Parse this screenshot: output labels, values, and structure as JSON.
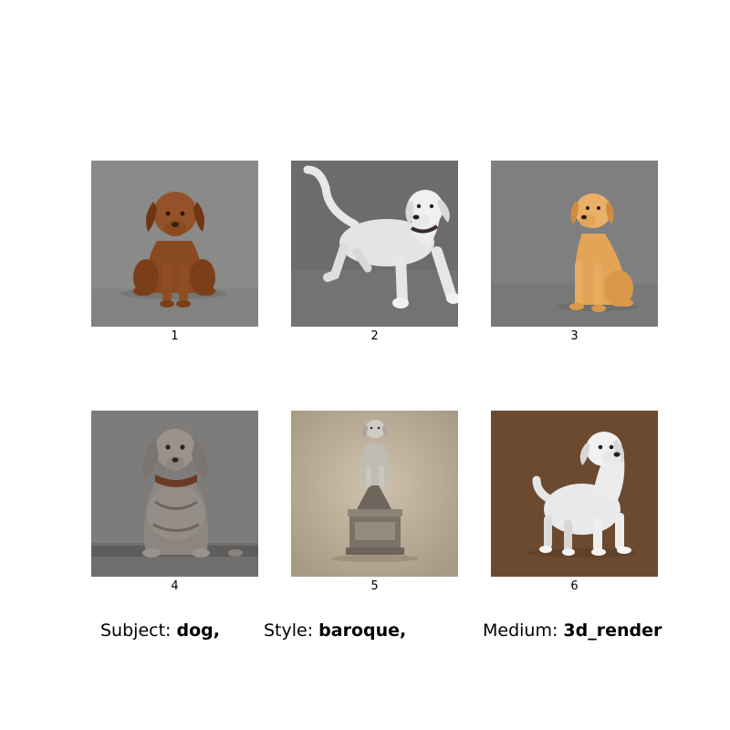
{
  "images": [
    {
      "number": "1",
      "content": "brown-dog-sitting"
    },
    {
      "number": "2",
      "content": "white-dog-standing-tail-up"
    },
    {
      "number": "3",
      "content": "golden-dog-sitting"
    },
    {
      "number": "4",
      "content": "grey-droopy-eared-dog-with-collar"
    },
    {
      "number": "5",
      "content": "dog-statue-on-pedestal"
    },
    {
      "number": "6",
      "content": "white-dog-on-brown-background"
    }
  ],
  "caption": {
    "subject_label": "Subject:",
    "subject_value": "dog,",
    "style_label": "Style:",
    "style_value": "baroque,",
    "medium_label": "Medium:",
    "medium_value": "3d_render"
  },
  "colors": {
    "page_background": "#ffffff",
    "tile1_bg": "#8a8a89",
    "tile2_bg": "#6c6c6c",
    "tile3_bg": "#7f7f7f",
    "tile4_bg": "#7d7c7b",
    "tile5_bg": "#b4a792",
    "tile6_bg": "#6b4a30"
  }
}
